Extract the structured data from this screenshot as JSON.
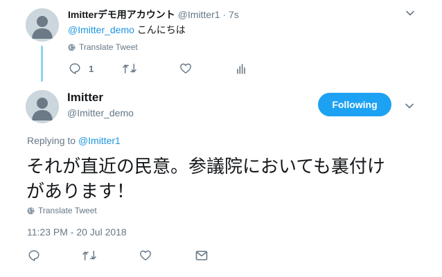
{
  "reply_tweet": {
    "display_name": "Imitterデモ用アカウント",
    "handle": "@Imitter1",
    "time": "· 7s",
    "mention": "@Imitter_demo",
    "text": "こんにちは",
    "translate_label": "Translate Tweet",
    "reply_count": "1"
  },
  "main_tweet": {
    "display_name": "Imitter",
    "handle": "@Imitter_demo",
    "follow_label": "Following",
    "replying_prefix": "Replying to",
    "replying_to": "@Imitter1",
    "text_line1": "それが直近の民意。参議院においても裏付け",
    "text_line2": "があります！",
    "translate_label": "Translate Tweet",
    "timestamp": "11:23 PM - 20 Jul 2018"
  },
  "colors": {
    "accent": "#1da1f2",
    "link": "#1b95e0",
    "muted": "#657786",
    "thread_line": "#8fd1f2"
  },
  "icons": [
    "default-avatar-icon",
    "chevron-down-icon",
    "globe-icon",
    "reply-icon",
    "retweet-icon",
    "like-icon",
    "analytics-icon",
    "message-icon"
  ]
}
